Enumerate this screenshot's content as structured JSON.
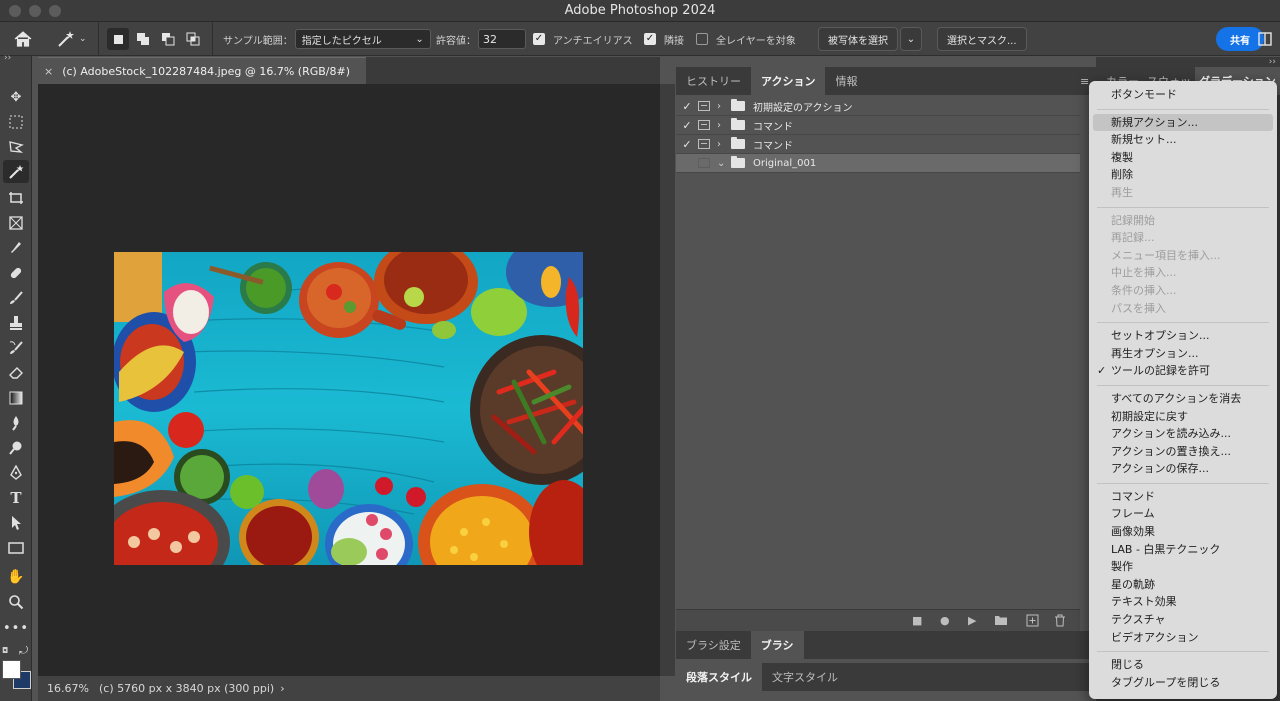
{
  "window": {
    "title": "Adobe Photoshop 2024"
  },
  "options_bar": {
    "sample_size_label": "サンプル範囲：",
    "sample_size_value": "指定したピクセル",
    "tolerance_label": "許容値：",
    "tolerance_value": "32",
    "anti_alias_label": "アンチエイリアス",
    "anti_alias_checked": true,
    "contiguous_label": "隣接",
    "contiguous_checked": true,
    "all_layers_label": "全レイヤーを対象",
    "all_layers_checked": false,
    "select_subject_label": "被写体を選択",
    "select_and_mask_label": "選択とマスク...",
    "share_label": "共有"
  },
  "document": {
    "tab_title": "(c) AdobeStock_102287484.jpeg @ 16.7% (RGB/8#)",
    "zoom": "16.67%",
    "info": "(c) 5760 px x 3840 px (300 ppi)"
  },
  "tools": [
    "move-tool-icon",
    "marquee-tool-icon",
    "lasso-tool-icon",
    "magic-wand-tool-icon",
    "quick-selection-tool-icon",
    "frame-tool-icon",
    "eyedropper-tool-icon",
    "healing-brush-tool-icon",
    "brush-tool-icon",
    "clone-stamp-tool-icon",
    "history-brush-tool-icon",
    "eraser-tool-icon",
    "gradient-tool-icon",
    "blur-tool-icon",
    "dodge-tool-icon",
    "pen-tool-icon",
    "type-tool-icon",
    "path-selection-tool-icon",
    "rectangle-tool-icon",
    "hand-tool-icon",
    "zoom-tool-icon",
    "more-tools-icon"
  ],
  "panels": {
    "top_tabs": [
      "ヒストリー",
      "アクション",
      "情報"
    ],
    "active_top_tab": "アクション",
    "actions": [
      {
        "checked": true,
        "dialog": true,
        "expanded": false,
        "label": "初期設定のアクション"
      },
      {
        "checked": true,
        "dialog": true,
        "expanded": false,
        "label": "コマンド"
      },
      {
        "checked": true,
        "dialog": true,
        "expanded": false,
        "label": "コマンド"
      },
      {
        "checked": false,
        "dialog": false,
        "expanded": true,
        "label": "Original_001",
        "selected": true
      }
    ],
    "brush_tabs": [
      "ブラシ設定",
      "ブラシ"
    ],
    "style_tabs": [
      "段落スタイル",
      "文字スタイル"
    ],
    "right_tabs": [
      "カラー",
      "スウォッ",
      "グラデーション"
    ]
  },
  "flyout_menu": {
    "items": [
      {
        "label": "ボタンモード"
      },
      {
        "sep": true
      },
      {
        "label": "新規アクション...",
        "highlighted": true
      },
      {
        "label": "新規セット..."
      },
      {
        "label": "複製"
      },
      {
        "label": "削除"
      },
      {
        "label": "再生",
        "disabled": true
      },
      {
        "sep": true
      },
      {
        "label": "記録開始",
        "disabled": true
      },
      {
        "label": "再記録...",
        "disabled": true
      },
      {
        "label": "メニュー項目を挿入...",
        "disabled": true
      },
      {
        "label": "中止を挿入...",
        "disabled": true
      },
      {
        "label": "条件の挿入...",
        "disabled": true
      },
      {
        "label": "パスを挿入",
        "disabled": true
      },
      {
        "sep": true
      },
      {
        "label": "セットオプション..."
      },
      {
        "label": "再生オプション..."
      },
      {
        "label": "ツールの記録を許可",
        "checked": true
      },
      {
        "sep": true
      },
      {
        "label": "すべてのアクションを消去"
      },
      {
        "label": "初期設定に戻す"
      },
      {
        "label": "アクションを読み込み..."
      },
      {
        "label": "アクションの置き換え..."
      },
      {
        "label": "アクションの保存..."
      },
      {
        "sep": true
      },
      {
        "label": "コマンド"
      },
      {
        "label": "フレーム"
      },
      {
        "label": "画像効果"
      },
      {
        "label": "LAB - 白黒テクニック"
      },
      {
        "label": "製作"
      },
      {
        "label": "星の軌跡"
      },
      {
        "label": "テキスト効果"
      },
      {
        "label": "テクスチャ"
      },
      {
        "label": "ビデオアクション"
      },
      {
        "sep": true
      },
      {
        "label": "閉じる"
      },
      {
        "label": "タブグループを閉じる"
      }
    ]
  },
  "colors": {
    "accent": "#1473e6",
    "panel": "#535353",
    "canvas": "#282828",
    "wood": "#16a9c6"
  }
}
